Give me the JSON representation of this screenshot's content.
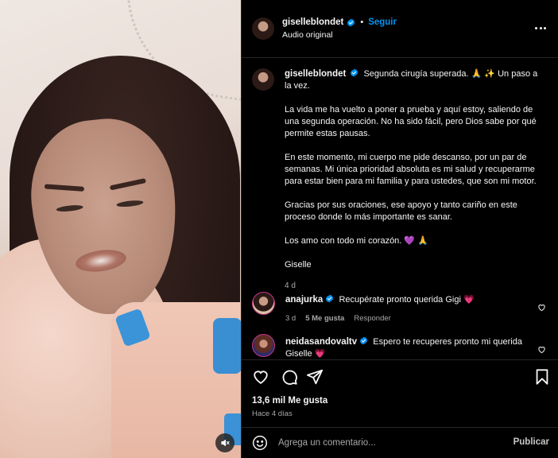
{
  "post": {
    "author": "giselleblondet",
    "follow_label": "Seguir",
    "dot": "•",
    "audio_label": "Audio original"
  },
  "caption": {
    "author": "giselleblondet",
    "first_line": "Segunda cirugía superada. 🙏 ✨ Un paso a la vez.",
    "paragraphs": [
      "La vida me ha vuelto a poner a prueba y aquí estoy, saliendo de una segunda operación. No ha sido fácil, pero Dios sabe por qué permite estas pausas.",
      "En este momento, mi cuerpo me pide descanso, por un par de semanas. Mi única prioridad absoluta es mi salud y recuperarme para estar bien para mi familia y para ustedes, que son mi motor.",
      "Gracias por sus oraciones, ese apoyo y tanto cariño en este proceso donde lo más importante es sanar.",
      "Los amo con todo mi corazón. 💜 🙏",
      "Giselle"
    ],
    "time": "4 d"
  },
  "comments": [
    {
      "author": "anajurka",
      "text": "Recupérate pronto querida Gigi 💗",
      "time": "3 d",
      "likes": "5 Me gusta",
      "reply": "Responder"
    },
    {
      "author": "neidasandovaltv",
      "text": "Espero te recuperes pronto mi querida Giselle 💗"
    }
  ],
  "stats": {
    "likes": "13,6 mil Me gusta",
    "ago": "Hace 4 días"
  },
  "composer": {
    "placeholder": "Agrega un comentario...",
    "publish": "Publicar"
  },
  "icons": {
    "verified": "verified-badge-icon",
    "more": "more-options-icon",
    "heart": "heart-icon",
    "comment": "comment-icon",
    "share": "share-icon",
    "save": "bookmark-icon",
    "emoji": "emoji-icon",
    "mute": "muted-speaker-icon"
  },
  "colors": {
    "accent": "#0095f6",
    "background": "#000000",
    "text": "#f5f5f5",
    "muted": "#a8a8a8"
  }
}
